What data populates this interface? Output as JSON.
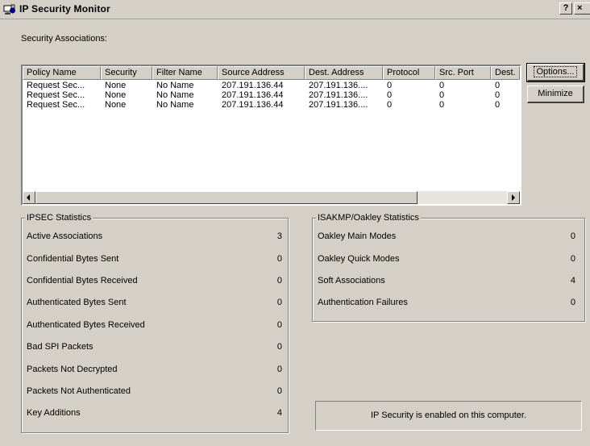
{
  "window": {
    "title": "IP Security Monitor",
    "help_button": "?",
    "close_button": "×"
  },
  "security_associations": {
    "label": "Security Associations:",
    "columns": [
      "Policy Name",
      "Security",
      "Filter Name",
      "Source Address",
      "Dest. Address",
      "Protocol",
      "Src. Port",
      "Dest."
    ],
    "rows": [
      [
        "Request Sec...",
        "None",
        "No Name",
        "207.191.136.44",
        "207.191.136....",
        "0",
        "0",
        "0"
      ],
      [
        "Request Sec...",
        "None",
        "No Name",
        "207.191.136.44",
        "207.191.136....",
        "0",
        "0",
        "0"
      ],
      [
        "Request Sec...",
        "None",
        "No Name",
        "207.191.136.44",
        "207.191.136....",
        "0",
        "0",
        "0"
      ]
    ]
  },
  "buttons": {
    "options_label": "Options...",
    "minimize_label": "Minimize"
  },
  "ipsec_stats": {
    "title": "IPSEC Statistics",
    "items": [
      {
        "label": "Active Associations",
        "value": "3"
      },
      {
        "label": "Confidential Bytes Sent",
        "value": "0"
      },
      {
        "label": "Confidential Bytes Received",
        "value": "0"
      },
      {
        "label": "Authenticated Bytes Sent",
        "value": "0"
      },
      {
        "label": "Authenticated Bytes Received",
        "value": "0"
      },
      {
        "label": "Bad SPI Packets",
        "value": "0"
      },
      {
        "label": "Packets Not Decrypted",
        "value": "0"
      },
      {
        "label": "Packets Not Authenticated",
        "value": "0"
      },
      {
        "label": "Key Additions",
        "value": "4"
      }
    ]
  },
  "isakmp_stats": {
    "title": "ISAKMP/Oakley Statistics",
    "items": [
      {
        "label": "Oakley Main Modes",
        "value": "0"
      },
      {
        "label": "Oakley Quick Modes",
        "value": "0"
      },
      {
        "label": "Soft Associations",
        "value": "4"
      },
      {
        "label": "Authentication Failures",
        "value": "0"
      }
    ]
  },
  "status": {
    "text": "IP Security is enabled on this computer."
  },
  "icons": {
    "app": "ip-security-monitor-icon",
    "scroll_left": "arrow-left-icon",
    "scroll_right": "arrow-right-icon"
  }
}
